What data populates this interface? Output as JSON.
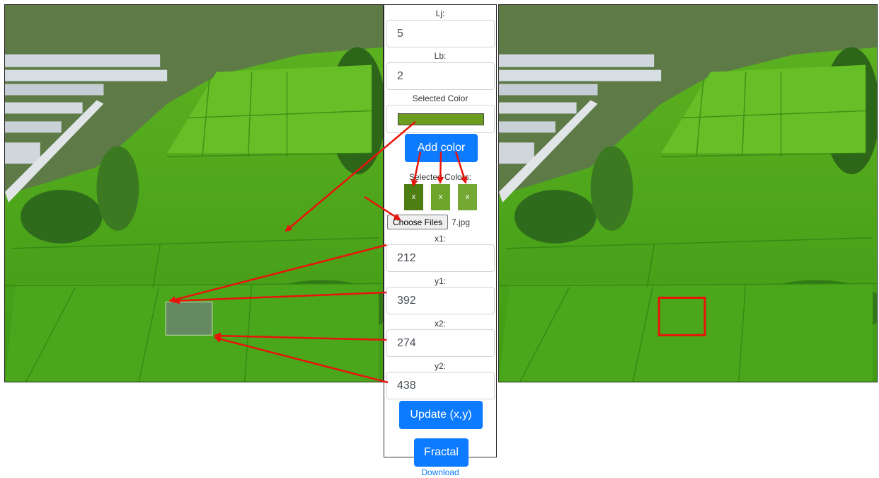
{
  "panel": {
    "lj_label": "Lj:",
    "lj_value": "5",
    "lb_label": "Lb:",
    "lb_value": "2",
    "selected_color_label": "Selected Color",
    "selected_color": "#6b9e1f",
    "add_color_label": "Add color",
    "selected_colors_label": "Selected Colors:",
    "selected_colors": [
      {
        "color": "#4e7d12",
        "remove_label": "x"
      },
      {
        "color": "#6da42a",
        "remove_label": "x"
      },
      {
        "color": "#74a832",
        "remove_label": "x"
      }
    ],
    "choose_files_label": "Choose Files",
    "file_name": "7.jpg",
    "x1_label": "x1:",
    "x1_value": "212",
    "y1_label": "y1:",
    "y1_value": "392",
    "x2_label": "x2:",
    "x2_value": "274",
    "y2_label": "y2:",
    "y2_value": "438",
    "update_label": "Update (x,y)",
    "fractal_label": "Fractal",
    "download_label": "Download"
  },
  "colors": {
    "accent": "#0d7bff",
    "arrow": "#e8140c",
    "selection_box": "#e8140c"
  }
}
